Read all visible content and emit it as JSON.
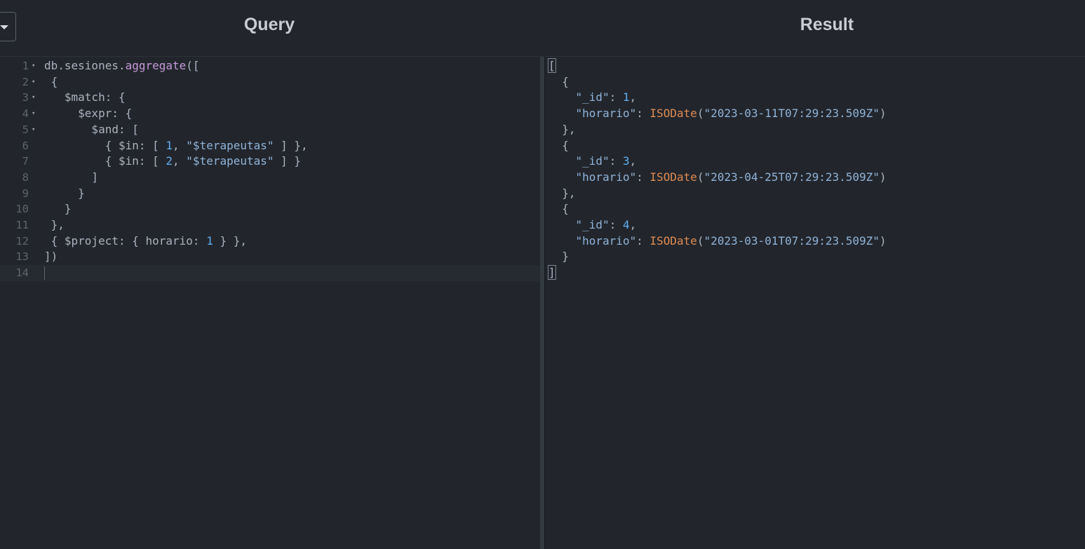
{
  "header": {
    "query_title": "Query",
    "result_title": "Result"
  },
  "icons": {
    "dropdown": "chevron-down-icon",
    "fold": "fold-arrow-icon"
  },
  "colors": {
    "background": "#22262c",
    "function": "#c59ad9",
    "number": "#61afef",
    "string": "#8fb3d9",
    "iso_date": "#e08b52",
    "gutter": "#5c6370"
  },
  "query": {
    "line_numbers": [
      "1",
      "2",
      "3",
      "4",
      "5",
      "6",
      "7",
      "8",
      "9",
      "10",
      "11",
      "12",
      "13",
      "14"
    ],
    "lines": [
      {
        "tokens": [
          {
            "t": "db.sesiones.",
            "c": "k-plain"
          },
          {
            "t": "aggregate",
            "c": "k-fn"
          },
          {
            "t": "([",
            "c": "k-plain"
          }
        ]
      },
      {
        "tokens": [
          {
            "t": " {",
            "c": "k-plain"
          }
        ]
      },
      {
        "tokens": [
          {
            "t": "   $match: {",
            "c": "k-plain"
          }
        ]
      },
      {
        "tokens": [
          {
            "t": "     $expr: {",
            "c": "k-plain"
          }
        ]
      },
      {
        "tokens": [
          {
            "t": "       $and: [",
            "c": "k-plain"
          }
        ]
      },
      {
        "tokens": [
          {
            "t": "         { $in: [ ",
            "c": "k-plain"
          },
          {
            "t": "1",
            "c": "k-num"
          },
          {
            "t": ", ",
            "c": "k-plain"
          },
          {
            "t": "\"$terapeutas\"",
            "c": "k-str"
          },
          {
            "t": " ] },",
            "c": "k-plain"
          }
        ]
      },
      {
        "tokens": [
          {
            "t": "         { $in: [ ",
            "c": "k-plain"
          },
          {
            "t": "2",
            "c": "k-num"
          },
          {
            "t": ", ",
            "c": "k-plain"
          },
          {
            "t": "\"$terapeutas\"",
            "c": "k-str"
          },
          {
            "t": " ] }",
            "c": "k-plain"
          }
        ]
      },
      {
        "tokens": [
          {
            "t": "       ]",
            "c": "k-plain"
          }
        ]
      },
      {
        "tokens": [
          {
            "t": "     }",
            "c": "k-plain"
          }
        ]
      },
      {
        "tokens": [
          {
            "t": "   }",
            "c": "k-plain"
          }
        ]
      },
      {
        "tokens": [
          {
            "t": " },",
            "c": "k-plain"
          }
        ]
      },
      {
        "tokens": [
          {
            "t": " { $project: { horario: ",
            "c": "k-plain"
          },
          {
            "t": "1",
            "c": "k-num"
          },
          {
            "t": " } },",
            "c": "k-plain"
          }
        ]
      },
      {
        "tokens": [
          {
            "t": "])",
            "c": "k-plain"
          }
        ]
      },
      {
        "tokens": []
      }
    ]
  },
  "result": {
    "lines": [
      {
        "tokens": [
          {
            "t": "[",
            "c": "k-plain"
          }
        ]
      },
      {
        "tokens": [
          {
            "t": "  {",
            "c": "k-plain"
          }
        ]
      },
      {
        "tokens": [
          {
            "t": "    \"_id\"",
            "c": "k-str"
          },
          {
            "t": ": ",
            "c": "k-plain"
          },
          {
            "t": "1",
            "c": "k-num"
          },
          {
            "t": ",",
            "c": "k-plain"
          }
        ]
      },
      {
        "tokens": [
          {
            "t": "    \"horario\"",
            "c": "k-str"
          },
          {
            "t": ": ",
            "c": "k-plain"
          },
          {
            "t": "ISODate",
            "c": "k-iso"
          },
          {
            "t": "(",
            "c": "k-plain"
          },
          {
            "t": "\"2023-03-11T07:29:23.509Z\"",
            "c": "k-str"
          },
          {
            "t": ")",
            "c": "k-plain"
          }
        ]
      },
      {
        "tokens": [
          {
            "t": "  },",
            "c": "k-plain"
          }
        ]
      },
      {
        "tokens": [
          {
            "t": "  {",
            "c": "k-plain"
          }
        ]
      },
      {
        "tokens": [
          {
            "t": "    \"_id\"",
            "c": "k-str"
          },
          {
            "t": ": ",
            "c": "k-plain"
          },
          {
            "t": "3",
            "c": "k-num"
          },
          {
            "t": ",",
            "c": "k-plain"
          }
        ]
      },
      {
        "tokens": [
          {
            "t": "    \"horario\"",
            "c": "k-str"
          },
          {
            "t": ": ",
            "c": "k-plain"
          },
          {
            "t": "ISODate",
            "c": "k-iso"
          },
          {
            "t": "(",
            "c": "k-plain"
          },
          {
            "t": "\"2023-04-25T07:29:23.509Z\"",
            "c": "k-str"
          },
          {
            "t": ")",
            "c": "k-plain"
          }
        ]
      },
      {
        "tokens": [
          {
            "t": "  },",
            "c": "k-plain"
          }
        ]
      },
      {
        "tokens": [
          {
            "t": "  {",
            "c": "k-plain"
          }
        ]
      },
      {
        "tokens": [
          {
            "t": "    \"_id\"",
            "c": "k-str"
          },
          {
            "t": ": ",
            "c": "k-plain"
          },
          {
            "t": "4",
            "c": "k-num"
          },
          {
            "t": ",",
            "c": "k-plain"
          }
        ]
      },
      {
        "tokens": [
          {
            "t": "    \"horario\"",
            "c": "k-str"
          },
          {
            "t": ": ",
            "c": "k-plain"
          },
          {
            "t": "ISODate",
            "c": "k-iso"
          },
          {
            "t": "(",
            "c": "k-plain"
          },
          {
            "t": "\"2023-03-01T07:29:23.509Z\"",
            "c": "k-str"
          },
          {
            "t": ")",
            "c": "k-plain"
          }
        ]
      },
      {
        "tokens": [
          {
            "t": "  }",
            "c": "k-plain"
          }
        ]
      },
      {
        "tokens": [
          {
            "t": "]",
            "c": "k-plain"
          }
        ]
      }
    ]
  }
}
